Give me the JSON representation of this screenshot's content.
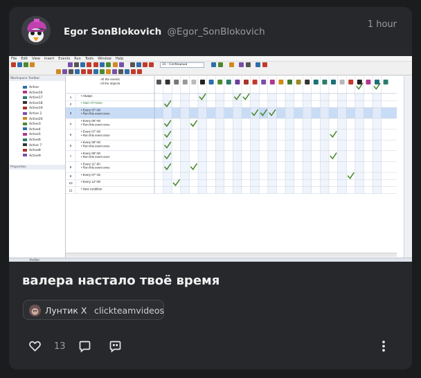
{
  "post": {
    "author_name": "Egor SonBlokovich",
    "author_handle": "@Egor_SonBlokovich",
    "time": "1 hour",
    "title": "валера настало твоё время",
    "channel": {
      "name": "Лунтик X",
      "handle": "clickteamvideos"
    },
    "likes": "13"
  },
  "icons": [
    "avatar",
    "play-icon",
    "volume-icon",
    "heart-icon",
    "comment-icon",
    "quote-icon",
    "more-icon"
  ],
  "video": {
    "menu": [
      "File",
      "Edit",
      "View",
      "Insert",
      "Events",
      "Run",
      "Tools",
      "Window",
      "Help"
    ],
    "frame_select": "31 - Сосбоцкыи",
    "workspace_title": "Workspace Toolbar",
    "properties_title": "Properties",
    "tree_items": [
      "Active",
      "Active16",
      "Active17",
      "Active18",
      "Active19",
      "Active 2",
      "Active20",
      "Active3",
      "Active4",
      "Active5",
      "Active6",
      "Active 7",
      "Active8",
      "Active9"
    ],
    "header_lines": [
      "All the events",
      "All the objects"
    ],
    "events": [
      {
        "num": "1",
        "lines": [
          "Always"
        ],
        "checks": [
          5,
          9,
          10
        ]
      },
      {
        "num": "2",
        "lines": [
          "Start of Frame"
        ],
        "checks": [
          1
        ]
      },
      {
        "num": "3",
        "lines": [
          "Every 07\"-00",
          "Run this event once"
        ],
        "checks": [
          11,
          12,
          13
        ]
      },
      {
        "num": "4",
        "lines": [
          "Every 06\"-00",
          "Run this event once"
        ],
        "checks": [
          1,
          4
        ]
      },
      {
        "num": "5",
        "lines": [
          "Every 07\"-00",
          "Run this event once"
        ],
        "checks": [
          1,
          20
        ]
      },
      {
        "num": "6",
        "lines": [
          "Every 09\"-00",
          "Run this event once"
        ],
        "checks": [
          1
        ]
      },
      {
        "num": "7",
        "lines": [
          "Every 09\"-00",
          "Run this event once"
        ],
        "checks": [
          1,
          20
        ]
      },
      {
        "num": "8",
        "lines": [
          "Every 11\"-00",
          "Run this event once"
        ],
        "checks": [
          1,
          4
        ]
      },
      {
        "num": "9",
        "lines": [
          "Every 07\"-32"
        ],
        "checks": [
          22
        ]
      },
      {
        "num": "10",
        "lines": [
          "Every 12\"-00"
        ],
        "checks": [
          2
        ]
      },
      {
        "num": "11",
        "lines": [
          "New condition"
        ],
        "checks": []
      }
    ],
    "top_checks": [
      23,
      25
    ],
    "status_text": "Profiler"
  },
  "colors": {
    "page_bg": "#1b1c1e",
    "card_bg": "#27282b",
    "check": "#4b8a2f",
    "highlight_row": "#c9dcf6"
  }
}
